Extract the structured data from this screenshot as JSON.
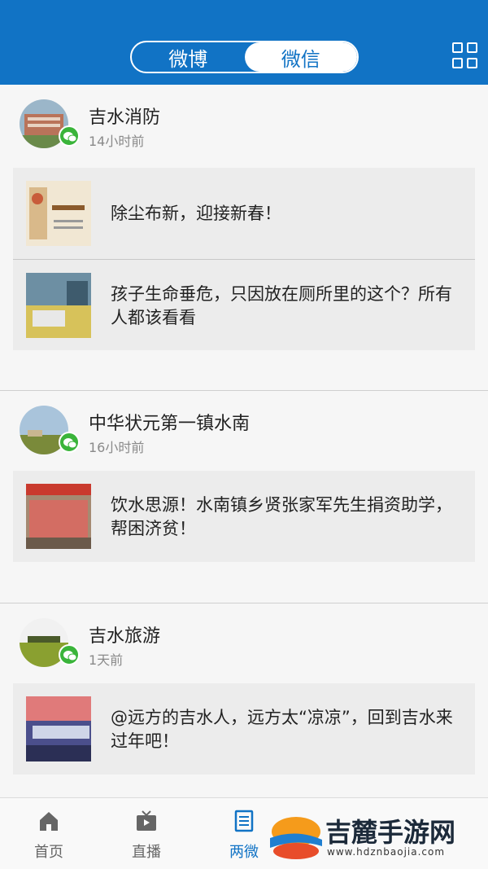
{
  "header": {
    "tabs": [
      "微博",
      "微信"
    ],
    "active_tab": "微信",
    "grid_icon": "grid-menu-icon",
    "background": "#1173c5"
  },
  "feed": [
    {
      "author": "吉水消防",
      "time": "14小时前",
      "articles": [
        {
          "title": "除尘布新，迎接新春！"
        },
        {
          "title": "孩子生命垂危，只因放在厕所里的这个？所有人都该看看"
        }
      ]
    },
    {
      "author": "中华状元第一镇水南",
      "time": "16小时前",
      "articles": [
        {
          "title": "饮水思源！水南镇乡贤张家军先生捐资助学，帮困济贫！"
        }
      ]
    },
    {
      "author": "吉水旅游",
      "time": "1天前",
      "articles": [
        {
          "title": "@远方的吉水人，远方太“凉凉”，回到吉水来过年吧！"
        }
      ]
    }
  ],
  "tabbar": {
    "items": [
      {
        "label": "首页",
        "icon": "home-icon"
      },
      {
        "label": "直播",
        "icon": "tv-icon"
      },
      {
        "label": "两微",
        "icon": "document-icon"
      }
    ],
    "active": "两微"
  },
  "watermark": {
    "text": "吉麓手游网",
    "url": "www.hdznbaojia.com"
  },
  "badge_icon": "wechat-icon"
}
